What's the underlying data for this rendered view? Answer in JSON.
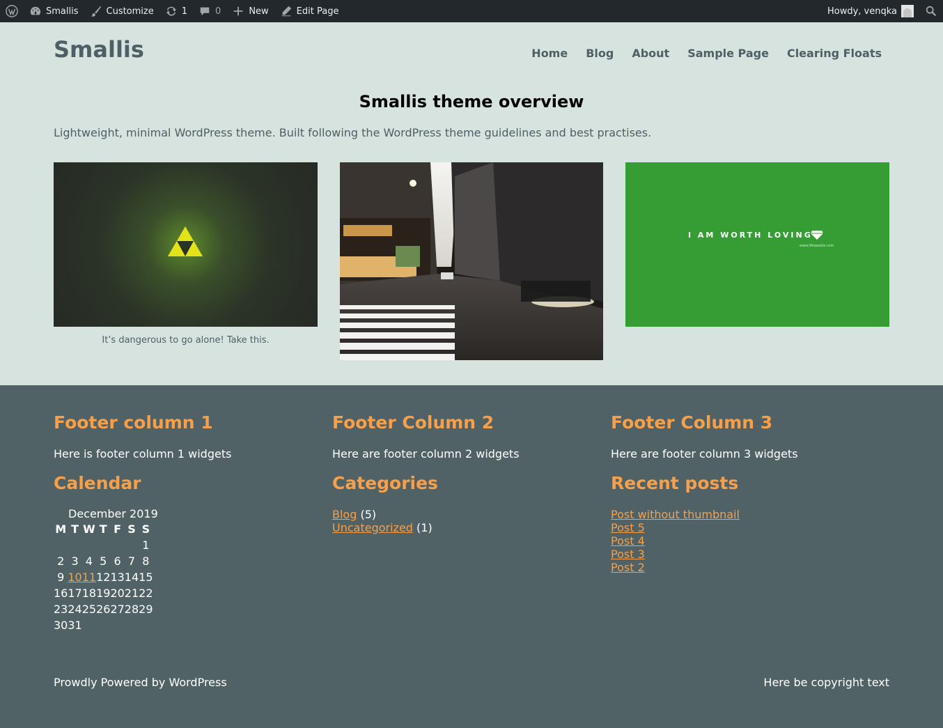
{
  "adminbar": {
    "site": "Smallis",
    "customize": "Customize",
    "updates_count": "1",
    "comments_count": "0",
    "new": "New",
    "edit_page": "Edit Page",
    "howdy": "Howdy, venqka"
  },
  "header": {
    "site_title": "Smallis",
    "nav": [
      "Home",
      "Blog",
      "About",
      "Sample Page",
      "Clearing Floats"
    ]
  },
  "main": {
    "title": "Smallis theme overview",
    "intro": "Lightweight, minimal WordPress theme. Built following the WordPress theme guidelines and best practises.",
    "gallery": {
      "caption_1": "It’s dangerous to go alone! Take this.",
      "image_3_text": "I AM WORTH LOVING",
      "image_3_subtext": "www.lifeawaits.com"
    }
  },
  "footer": {
    "col1": {
      "title": "Footer column 1",
      "text": "Here is footer column 1 widgets",
      "calendar_title": "Calendar",
      "calendar": {
        "caption": "December 2019",
        "headers": [
          "M",
          "T",
          "W",
          "T",
          "F",
          "S",
          "S"
        ],
        "weeks": [
          [
            "",
            "",
            "",
            "",
            "",
            "",
            "1"
          ],
          [
            "2",
            "3",
            "4",
            "5",
            "6",
            "7",
            "8"
          ],
          [
            "9",
            "10",
            "11",
            "12",
            "13",
            "14",
            "15"
          ],
          [
            "16",
            "17",
            "18",
            "19",
            "20",
            "21",
            "22"
          ],
          [
            "23",
            "24",
            "25",
            "26",
            "27",
            "28",
            "29"
          ],
          [
            "30",
            "31",
            "",
            "",
            "",
            "",
            ""
          ]
        ],
        "linked_days": [
          "10",
          "11"
        ]
      }
    },
    "col2": {
      "title": "Footer Column 2",
      "text": "Here are footer column 2 widgets",
      "categories_title": "Categories",
      "categories": [
        {
          "name": "Blog",
          "count": "(5)"
        },
        {
          "name": "Uncategorized",
          "count": "(1)"
        }
      ]
    },
    "col3": {
      "title": "Footer Column 3",
      "text": "Here are footer column 3 widgets",
      "recent_title": "Recent posts",
      "recent_posts": [
        "Post without thumbnail",
        "Post 5",
        "Post 4",
        "Post 3",
        "Post 2"
      ]
    },
    "powered": "Prowdly Powered by WordPress",
    "copyright": "Here be copyright text"
  },
  "colors": {
    "background": "#d7e3de",
    "text": "#4e6066",
    "footer_bg": "#506266",
    "accent": "#f79f49",
    "adminbar_bg": "#23282d"
  }
}
